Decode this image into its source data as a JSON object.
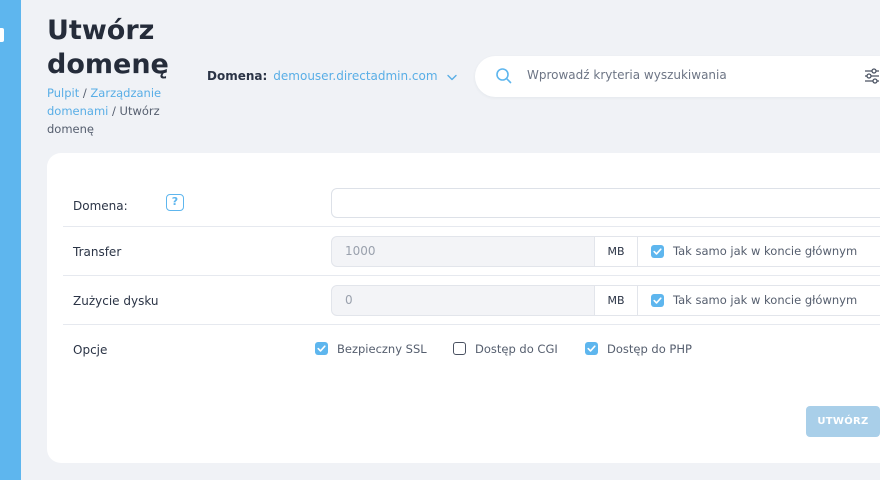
{
  "page": {
    "title": "Utwórz domenę",
    "breadcrumb": {
      "home": "Pulpit",
      "sep1": " / ",
      "section": "Zarządzanie domenami",
      "sep2": " / ",
      "current": "Utwórz domenę"
    }
  },
  "domain_selector": {
    "label": "Domena:",
    "value": "demouser.directadmin.com",
    "icon": "chevron-down-icon"
  },
  "search": {
    "placeholder": "Wprowadź kryteria wyszukiwania",
    "icon": "search-icon",
    "filter_icon": "filter-sliders-icon"
  },
  "form": {
    "domain": {
      "label": "Domena:",
      "help_icon": "?",
      "value": ""
    },
    "transfer": {
      "label": "Transfer",
      "value": "1000",
      "unit": "MB",
      "same_as_main_label": "Tak samo jak w koncie głównym",
      "same_as_main_checked": true
    },
    "disk": {
      "label": "Zużycie dysku",
      "value": "0",
      "unit": "MB",
      "same_as_main_label": "Tak samo jak w koncie głównym",
      "same_as_main_checked": true
    },
    "options": {
      "label": "Opcje",
      "items": [
        {
          "label": "Bezpieczny SSL",
          "checked": true
        },
        {
          "label": "Dostęp do CGI",
          "checked": false
        },
        {
          "label": "Dostęp do PHP",
          "checked": true
        }
      ]
    },
    "submit_label": "UTWÓRZ"
  },
  "colors": {
    "accent": "#5eb6ee",
    "button_disabled": "#a9cfe9",
    "background": "#f0f2f6"
  }
}
